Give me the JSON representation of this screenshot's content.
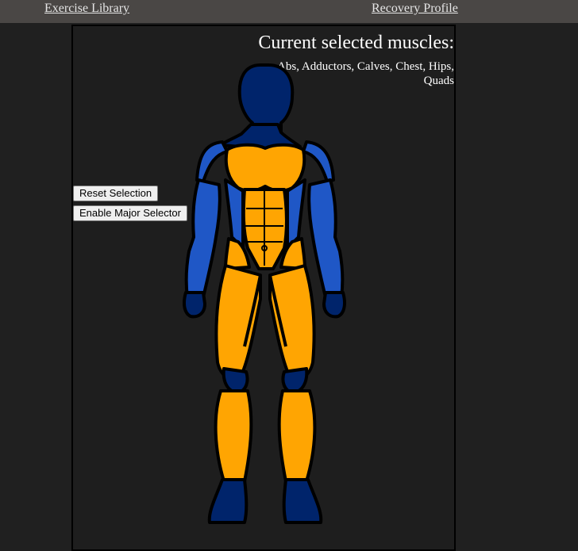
{
  "nav": {
    "exercise_library": "Exercise Library",
    "recovery_profile": "Recovery Profile"
  },
  "panel": {
    "title": "Current selected muscles:",
    "selected_muscles": "Abs, Adductors, Calves, Chest, Hips, Quads"
  },
  "buttons": {
    "reset": "Reset Selection",
    "major_selector": "Enable Major Selector"
  },
  "colors": {
    "selected": "#ffa502",
    "unselected": "#1f57c6",
    "head_hands_feet": "#00246b",
    "outline": "#000000"
  }
}
